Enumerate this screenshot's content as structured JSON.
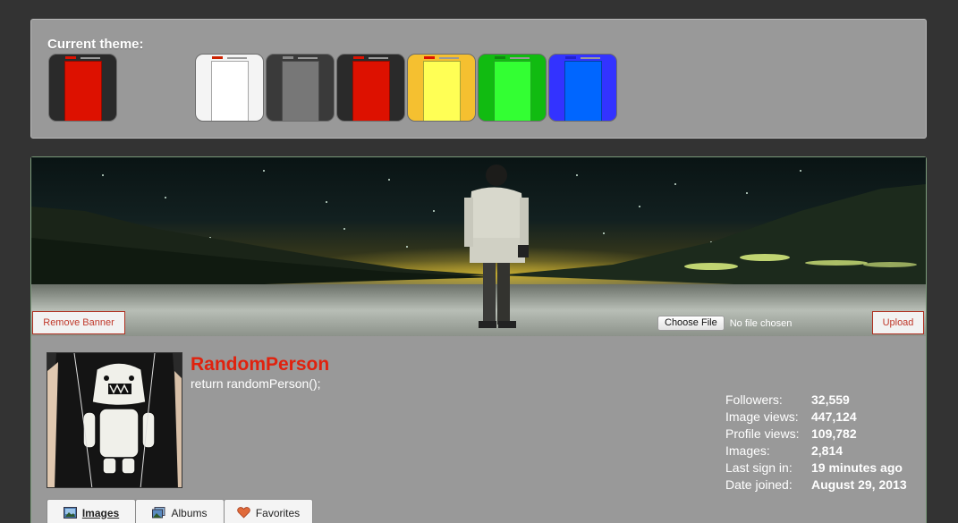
{
  "theme": {
    "title": "Current theme:",
    "current": {
      "outer": "#2a2a2a",
      "inner": "#dd1100",
      "logo": "#dd1100"
    },
    "options": [
      {
        "name": "white",
        "outer": "#f4f4f4",
        "inner": "#ffffff",
        "logo": "#cc2200"
      },
      {
        "name": "gray",
        "outer": "#3a3a3a",
        "inner": "#777777",
        "logo": "#888888"
      },
      {
        "name": "red",
        "outer": "#2a2a2a",
        "inner": "#dd1100",
        "logo": "#dd1100"
      },
      {
        "name": "yellow",
        "outer": "#f5c030",
        "inner": "#ffff55",
        "logo": "#dd1100"
      },
      {
        "name": "green",
        "outer": "#11bb11",
        "inner": "#33ff33",
        "logo": "#118811"
      },
      {
        "name": "blue",
        "outer": "#3333ff",
        "inner": "#0066ff",
        "logo": "#2222cc"
      }
    ]
  },
  "banner": {
    "remove_label": "Remove Banner",
    "choose_file_label": "Choose File",
    "no_file_text": "No file chosen",
    "upload_label": "Upload"
  },
  "profile": {
    "username": "RandomPerson",
    "tagline": "return randomPerson();",
    "stats": [
      {
        "label": "Followers:",
        "value": "32,559"
      },
      {
        "label": "Image views:",
        "value": "447,124"
      },
      {
        "label": "Profile views:",
        "value": "109,782"
      },
      {
        "label": "Images:",
        "value": "2,814"
      },
      {
        "label": "Last sign in:",
        "value": "19 minutes ago"
      },
      {
        "label": "Date joined:",
        "value": "August 29, 2013"
      }
    ]
  },
  "tabs": [
    {
      "label": "Images",
      "icon": "images-icon",
      "active": true
    },
    {
      "label": "Albums",
      "icon": "albums-icon",
      "active": false
    },
    {
      "label": "Favorites",
      "icon": "heart-icon",
      "active": false
    }
  ],
  "colors": {
    "username": "#e0220e",
    "panel": "#999999",
    "background": "#333333"
  }
}
